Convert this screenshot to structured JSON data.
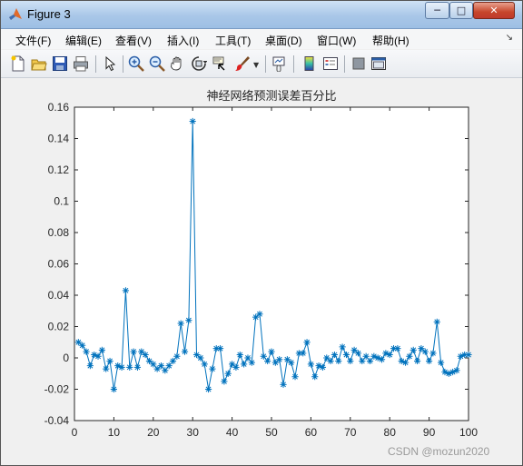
{
  "window": {
    "title": "Figure 3"
  },
  "menu": [
    {
      "label": "文件(F)"
    },
    {
      "label": "编辑(E)"
    },
    {
      "label": "查看(V)"
    },
    {
      "label": "插入(I)"
    },
    {
      "label": "工具(T)"
    },
    {
      "label": "桌面(D)"
    },
    {
      "label": "窗口(W)"
    },
    {
      "label": "帮助(H)"
    }
  ],
  "toolbar_icons": [
    "new-figure-icon",
    "open-file-icon",
    "save-icon",
    "print-icon",
    "edit-plot-icon",
    "zoom-in-icon",
    "zoom-out-icon",
    "pan-icon",
    "rotate-3d-icon",
    "data-cursor-icon",
    "brush-icon",
    "brush-dropdown-icon",
    "link-plot-icon",
    "insert-colorbar-icon",
    "insert-legend-icon",
    "hide-plot-tools-icon",
    "show-plot-tools-icon"
  ],
  "watermark": "CSDN @mozun2020",
  "chart_data": {
    "type": "line",
    "title": "神经网络预测误差百分比",
    "xlabel": "",
    "ylabel": "",
    "xlim": [
      0,
      100
    ],
    "ylim": [
      -0.04,
      0.16
    ],
    "xticks": [
      "0",
      "10",
      "20",
      "30",
      "40",
      "50",
      "60",
      "70",
      "80",
      "90",
      "100"
    ],
    "yticks": [
      "-0.04",
      "-0.02",
      "0",
      "0.02",
      "0.04",
      "0.06",
      "0.08",
      "0.1",
      "0.12",
      "0.14",
      "0.16"
    ],
    "grid": false,
    "marker": "*",
    "color": "#0072bd",
    "series": [
      {
        "x": [
          1,
          2,
          3,
          4,
          5,
          6,
          7,
          8,
          9,
          10,
          11,
          12,
          13,
          14,
          15,
          16,
          17,
          18,
          19,
          20,
          21,
          22,
          23,
          24,
          25,
          26,
          27,
          28,
          29,
          30,
          31,
          32,
          33,
          34,
          35,
          36,
          37,
          38,
          39,
          40,
          41,
          42,
          43,
          44,
          45,
          46,
          47,
          48,
          49,
          50,
          51,
          52,
          53,
          54,
          55,
          56,
          57,
          58,
          59,
          60,
          61,
          62,
          63,
          64,
          65,
          66,
          67,
          68,
          69,
          70,
          71,
          72,
          73,
          74,
          75,
          76,
          77,
          78,
          79,
          80,
          81,
          82,
          83,
          84,
          85,
          86,
          87,
          88,
          89,
          90,
          91,
          92,
          93,
          94,
          95,
          96,
          97,
          98,
          99,
          100
        ],
        "values": [
          0.01,
          0.008,
          0.004,
          -0.005,
          0.002,
          0.001,
          0.005,
          -0.007,
          -0.002,
          -0.02,
          -0.005,
          -0.006,
          0.043,
          -0.006,
          0.004,
          -0.006,
          0.004,
          0.002,
          -0.002,
          -0.004,
          -0.007,
          -0.005,
          -0.008,
          -0.005,
          -0.002,
          0.001,
          0.022,
          0.004,
          0.024,
          0.151,
          0.002,
          0.0,
          -0.004,
          -0.02,
          -0.007,
          0.006,
          0.006,
          -0.015,
          -0.01,
          -0.004,
          -0.006,
          0.002,
          -0.004,
          0.0,
          -0.003,
          0.026,
          0.028,
          0.001,
          -0.002,
          0.004,
          -0.003,
          -0.001,
          -0.017,
          -0.001,
          -0.003,
          -0.012,
          0.003,
          0.003,
          0.01,
          -0.004,
          -0.012,
          -0.005,
          -0.006,
          0.0,
          -0.002,
          0.002,
          -0.002,
          0.007,
          0.002,
          -0.002,
          0.005,
          0.003,
          -0.002,
          0.001,
          -0.002,
          0.001,
          0.0,
          -0.001,
          0.003,
          0.002,
          0.006,
          0.006,
          -0.002,
          -0.003,
          0.001,
          0.005,
          -0.002,
          0.006,
          0.004,
          -0.002,
          0.003,
          0.023,
          -0.003,
          -0.009,
          -0.01,
          -0.009,
          -0.008,
          0.001,
          0.002,
          0.002
        ]
      }
    ]
  }
}
